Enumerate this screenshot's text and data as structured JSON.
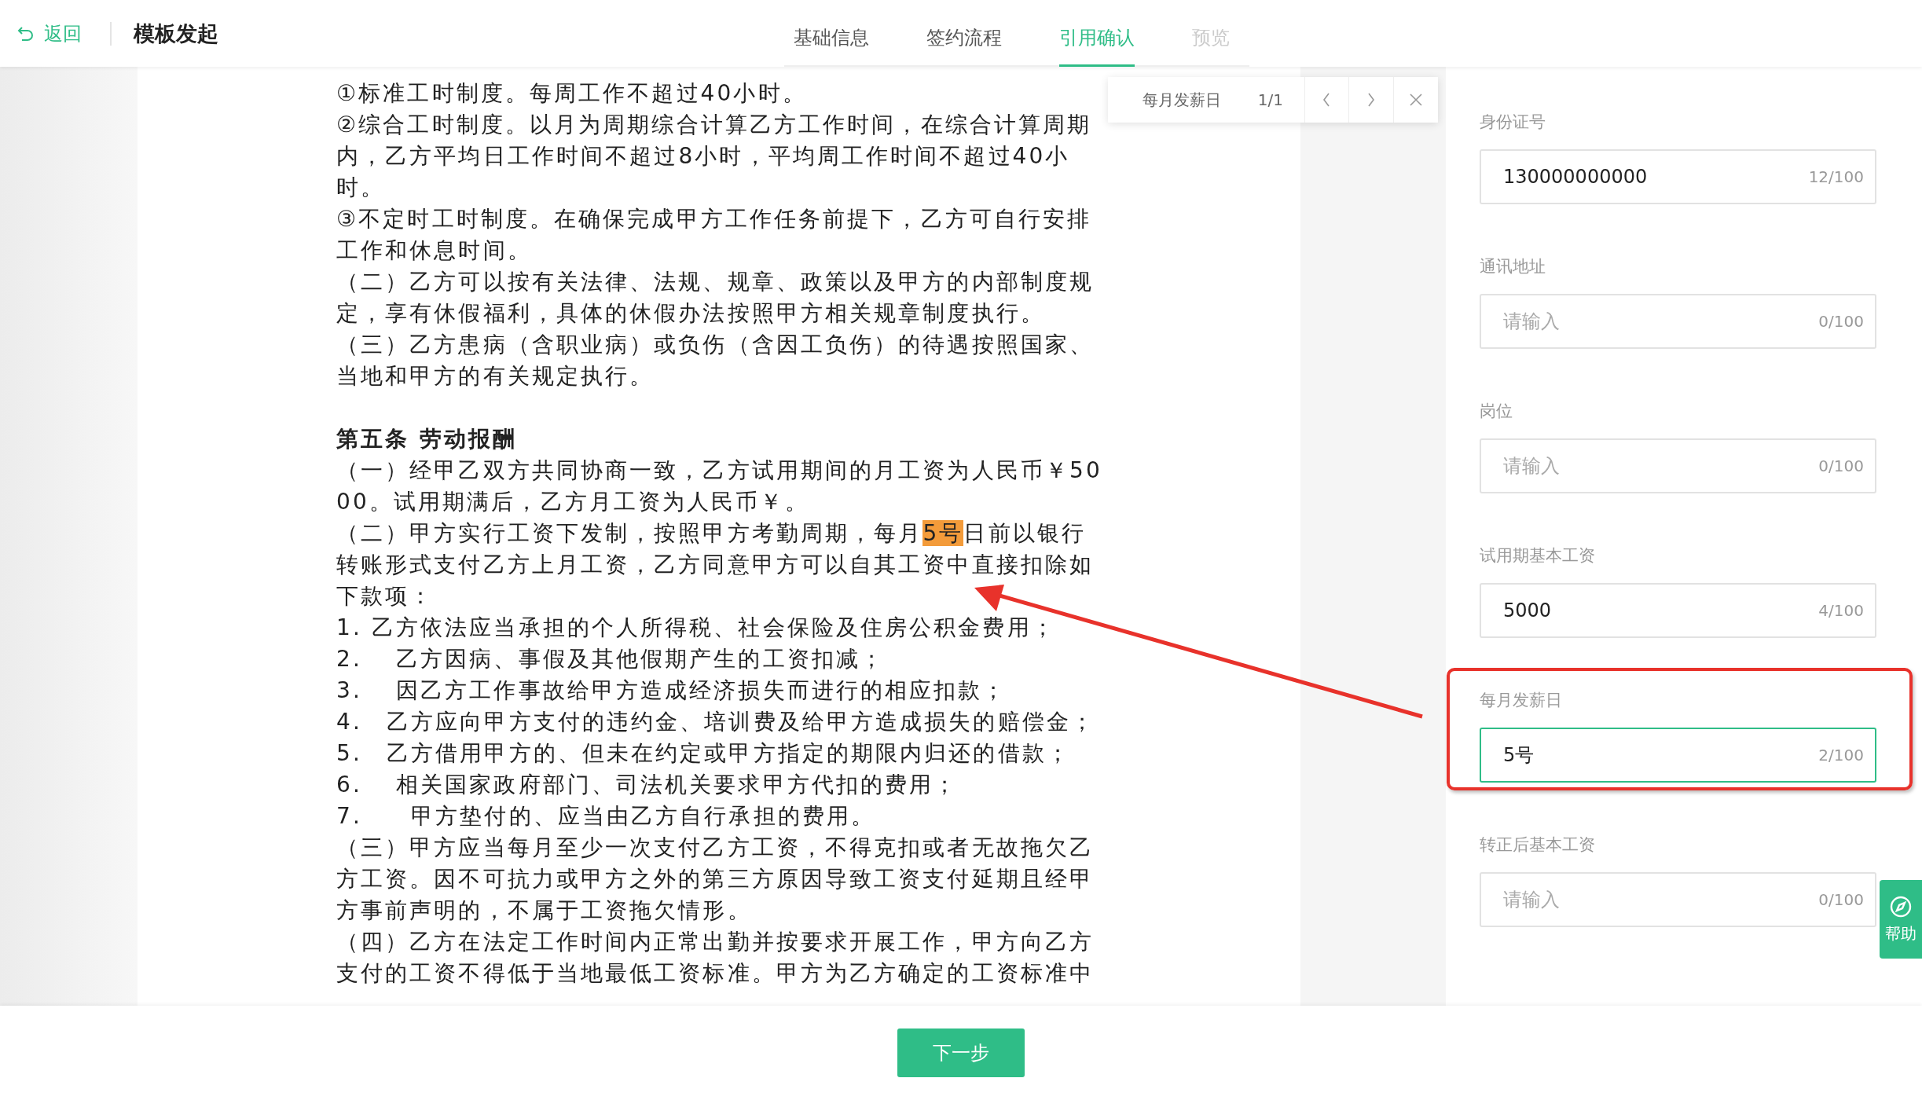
{
  "header": {
    "back_label": "返回",
    "title": "模板发起",
    "tabs": [
      {
        "label": "基础信息",
        "selected": false,
        "disabled": false
      },
      {
        "label": "签约流程",
        "selected": false,
        "disabled": false
      },
      {
        "label": "引用确认",
        "selected": true,
        "disabled": false
      },
      {
        "label": "预览",
        "selected": false,
        "disabled": true
      }
    ]
  },
  "search_popup": {
    "query": "每月发薪日",
    "count": "1/1"
  },
  "document": {
    "paragraphs": [
      {
        "kind": "text",
        "text": "①标准工时制度。每周工作不超过40小时。"
      },
      {
        "kind": "text",
        "text": "②综合工时制度。以月为周期综合计算乙方工作时间，在综合计算周期内，乙方平均日工作时间不超过8小时，平均周工作时间不超过40小时。"
      },
      {
        "kind": "text",
        "text": "③不定时工时制度。在确保完成甲方工作任务前提下，乙方可自行安排工作和休息时间。"
      },
      {
        "kind": "text",
        "text": "（二）乙方可以按有关法律、法规、规章、政策以及甲方的内部制度规定，享有休假福利，具体的休假办法按照甲方相关规章制度执行。"
      },
      {
        "kind": "text",
        "text": "（三）乙方患病（含职业病）或负伤（含因工负伤）的待遇按照国家、当地和甲方的有关规定执行。"
      },
      {
        "kind": "heading",
        "text": "第五条 劳动报酬"
      },
      {
        "kind": "text",
        "text": "（一）经甲乙双方共同协商一致，乙方试用期间的月工资为人民币￥5000。试用期满后，乙方月工资为人民币￥。"
      },
      {
        "kind": "match",
        "before": "（二）甲方实行工资下发制，按照甲方考勤周期，每月",
        "match": "5号",
        "after": "日前以银行转账形式支付乙方上月工资，乙方同意甲方可以自其工资中直接扣除如下款项："
      },
      {
        "kind": "text",
        "text": "1. 乙方依法应当承担的个人所得税、社会保险及住房公积金费用；"
      },
      {
        "kind": "text",
        "text": "2.　 乙方因病、事假及其他假期产生的工资扣减；"
      },
      {
        "kind": "text",
        "text": "3.　 因乙方工作事故给甲方造成经济损失而进行的相应扣款；"
      },
      {
        "kind": "text",
        "text": "4.　乙方应向甲方支付的违约金、培训费及给甲方造成损失的赔偿金；"
      },
      {
        "kind": "text",
        "text": "5.　乙方借用甲方的、但未在约定或甲方指定的期限内归还的借款；"
      },
      {
        "kind": "text",
        "text": "6.　 相关国家政府部门、司法机关要求甲方代扣的费用；"
      },
      {
        "kind": "text",
        "text": "7.　　甲方垫付的、应当由乙方自行承担的费用。"
      },
      {
        "kind": "text",
        "text": "（三）甲方应当每月至少一次支付乙方工资，不得克扣或者无故拖欠乙方工资。因不可抗力或甲方之外的第三方原因导致工资支付延期且经甲方事前声明的，不属于工资拖欠情形。"
      },
      {
        "kind": "text",
        "text": "（四）乙方在法定工作时间内正常出勤并按要求开展工作，甲方向乙方支付的工资不得低于当地最低工资标准。甲方为乙方确定的工资标准中"
      }
    ]
  },
  "fields": [
    {
      "label": "身份证号",
      "value": "130000000000",
      "counter": "12/100",
      "focused": false
    },
    {
      "label": "通讯地址",
      "placeholder": "请输入",
      "counter": "0/100",
      "focused": false
    },
    {
      "label": "岗位",
      "placeholder": "请输入",
      "counter": "0/100",
      "focused": false
    },
    {
      "label": "试用期基本工资",
      "value": "5000",
      "counter": "4/100",
      "focused": false
    },
    {
      "label": "每月发薪日",
      "value": "5号",
      "counter": "2/100",
      "focused": true
    },
    {
      "label": "转正后基本工资",
      "placeholder": "请输入",
      "counter": "0/100",
      "focused": false
    }
  ],
  "help_button": {
    "label": "帮助"
  },
  "footer": {
    "next_button": "下一步"
  }
}
